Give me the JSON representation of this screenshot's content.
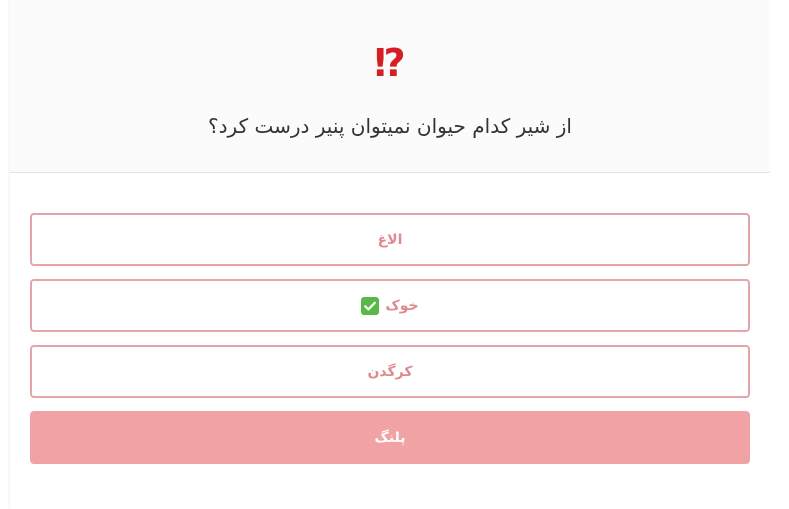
{
  "quiz": {
    "icon": {
      "name": "interrobang-icon",
      "glyph": "⁉"
    },
    "question": "از شیر کدام حیوان نمیتوان پنیر درست کرد؟",
    "colors": {
      "accent": "#d51f24",
      "option_border": "#e3a5a9",
      "option_text": "#de8a8f",
      "selected_bg": "#f0a2a4",
      "check_green": "#58b947"
    },
    "options": [
      {
        "label": "الاغ",
        "correct": false,
        "selected": false
      },
      {
        "label": "خوک",
        "correct": true,
        "selected": false,
        "icon": "check-mark-icon"
      },
      {
        "label": "کرگدن",
        "correct": false,
        "selected": false
      },
      {
        "label": "پلنگ",
        "correct": false,
        "selected": true
      }
    ]
  }
}
